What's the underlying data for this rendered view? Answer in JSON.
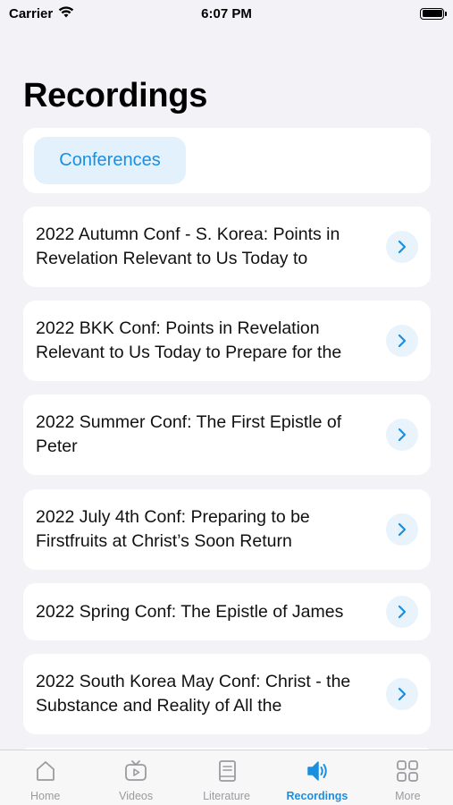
{
  "status": {
    "carrier": "Carrier",
    "time": "6:07 PM"
  },
  "header": {
    "title": "Recordings"
  },
  "filter": {
    "chip_label": "Conferences"
  },
  "recordings": [
    {
      "title": "2022 Autumn Conf - S. Korea: Points in Revelation Relevant to Us Today to"
    },
    {
      "title": "2022 BKK Conf: Points in Revelation Relevant to Us Today to Prepare for the"
    },
    {
      "title": "2022 Summer Conf: The First Epistle of Peter"
    },
    {
      "title": "2022 July 4th Conf: Preparing to be Firstfruits at Christ’s Soon Return"
    },
    {
      "title": "2022 Spring Conf: The Epistle of James"
    },
    {
      "title": "2022 South Korea May Conf: Christ - the Substance and Reality of All the"
    }
  ],
  "tabs": [
    {
      "label": "Home",
      "icon": "home-icon"
    },
    {
      "label": "Videos",
      "icon": "tv-play-icon"
    },
    {
      "label": "Literature",
      "icon": "book-icon"
    },
    {
      "label": "Recordings",
      "icon": "speaker-icon",
      "active": true
    },
    {
      "label": "More",
      "icon": "grid-icon"
    }
  ],
  "colors": {
    "accent": "#1a8fe0",
    "background": "#f2f2f7",
    "chip_bg": "#e3f1fc"
  }
}
